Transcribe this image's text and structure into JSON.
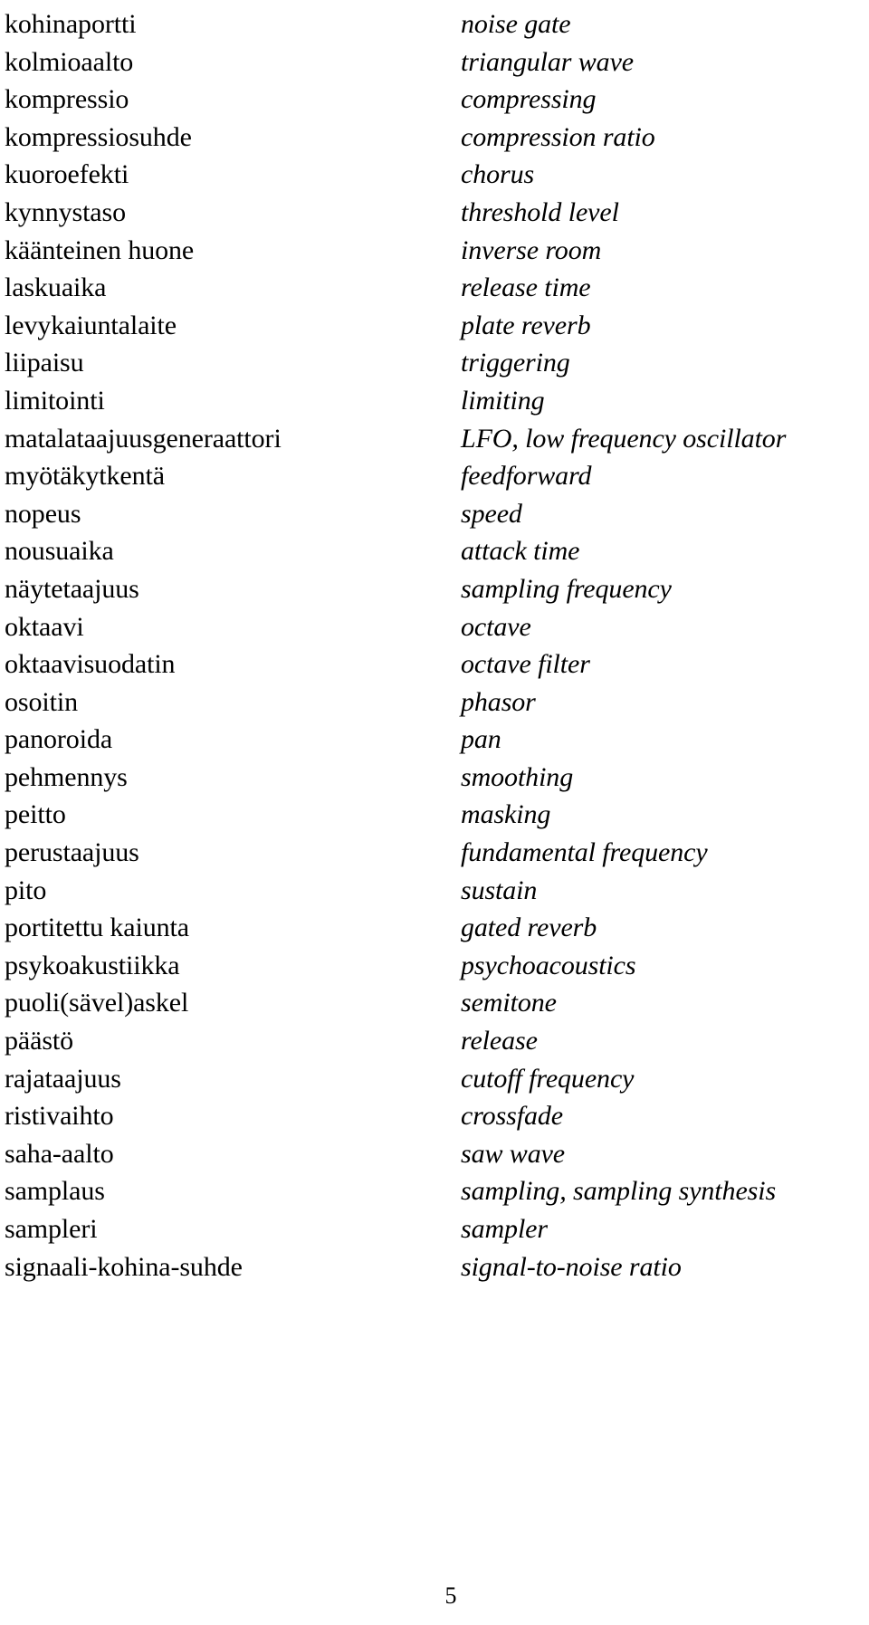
{
  "document": {
    "type": "glossary",
    "columns": {
      "source_language": "Finnish",
      "target_language": "English"
    },
    "page_number": "5"
  },
  "entries": [
    {
      "fi": "kohinaportti",
      "en": "noise gate"
    },
    {
      "fi": "kolmioaalto",
      "en": "triangular wave"
    },
    {
      "fi": "kompressio",
      "en": "compressing"
    },
    {
      "fi": "kompressiosuhde",
      "en": "compression ratio"
    },
    {
      "fi": "kuoroefekti",
      "en": "chorus"
    },
    {
      "fi": "kynnystaso",
      "en": "threshold level"
    },
    {
      "fi": "käänteinen huone",
      "en": "inverse room"
    },
    {
      "fi": "laskuaika",
      "en": "release time"
    },
    {
      "fi": "levykaiuntalaite",
      "en": "plate reverb"
    },
    {
      "fi": "liipaisu",
      "en": "triggering"
    },
    {
      "fi": "limitointi",
      "en": "limiting"
    },
    {
      "fi": "matalataajuusgeneraattori",
      "en": "LFO, low frequency oscillator"
    },
    {
      "fi": "myötäkytkentä",
      "en": "feedforward"
    },
    {
      "fi": "nopeus",
      "en": "speed"
    },
    {
      "fi": "nousuaika",
      "en": "attack time"
    },
    {
      "fi": "näytetaajuus",
      "en": "sampling frequency"
    },
    {
      "fi": "oktaavi",
      "en": "octave"
    },
    {
      "fi": "oktaavisuodatin",
      "en": "octave filter"
    },
    {
      "fi": "osoitin",
      "en": "phasor"
    },
    {
      "fi": "panoroida",
      "en": "pan"
    },
    {
      "fi": "pehmennys",
      "en": "smoothing"
    },
    {
      "fi": "peitto",
      "en": "masking"
    },
    {
      "fi": "perustaajuus",
      "en": "fundamental frequency"
    },
    {
      "fi": "pito",
      "en": "sustain"
    },
    {
      "fi": "portitettu kaiunta",
      "en": "gated reverb"
    },
    {
      "fi": "psykoakustiikka",
      "en": "psychoacoustics"
    },
    {
      "fi": "puoli(sävel)askel",
      "en": "semitone"
    },
    {
      "fi": "päästö",
      "en": "release"
    },
    {
      "fi": "rajataajuus",
      "en": "cutoff frequency"
    },
    {
      "fi": "ristivaihto",
      "en": "crossfade"
    },
    {
      "fi": "saha-aalto",
      "en": "saw wave"
    },
    {
      "fi": "samplaus",
      "en": "sampling, sampling synthesis"
    },
    {
      "fi": "sampleri",
      "en": "sampler"
    },
    {
      "fi": "signaali-kohina-suhde",
      "en": "signal-to-noise ratio"
    }
  ]
}
